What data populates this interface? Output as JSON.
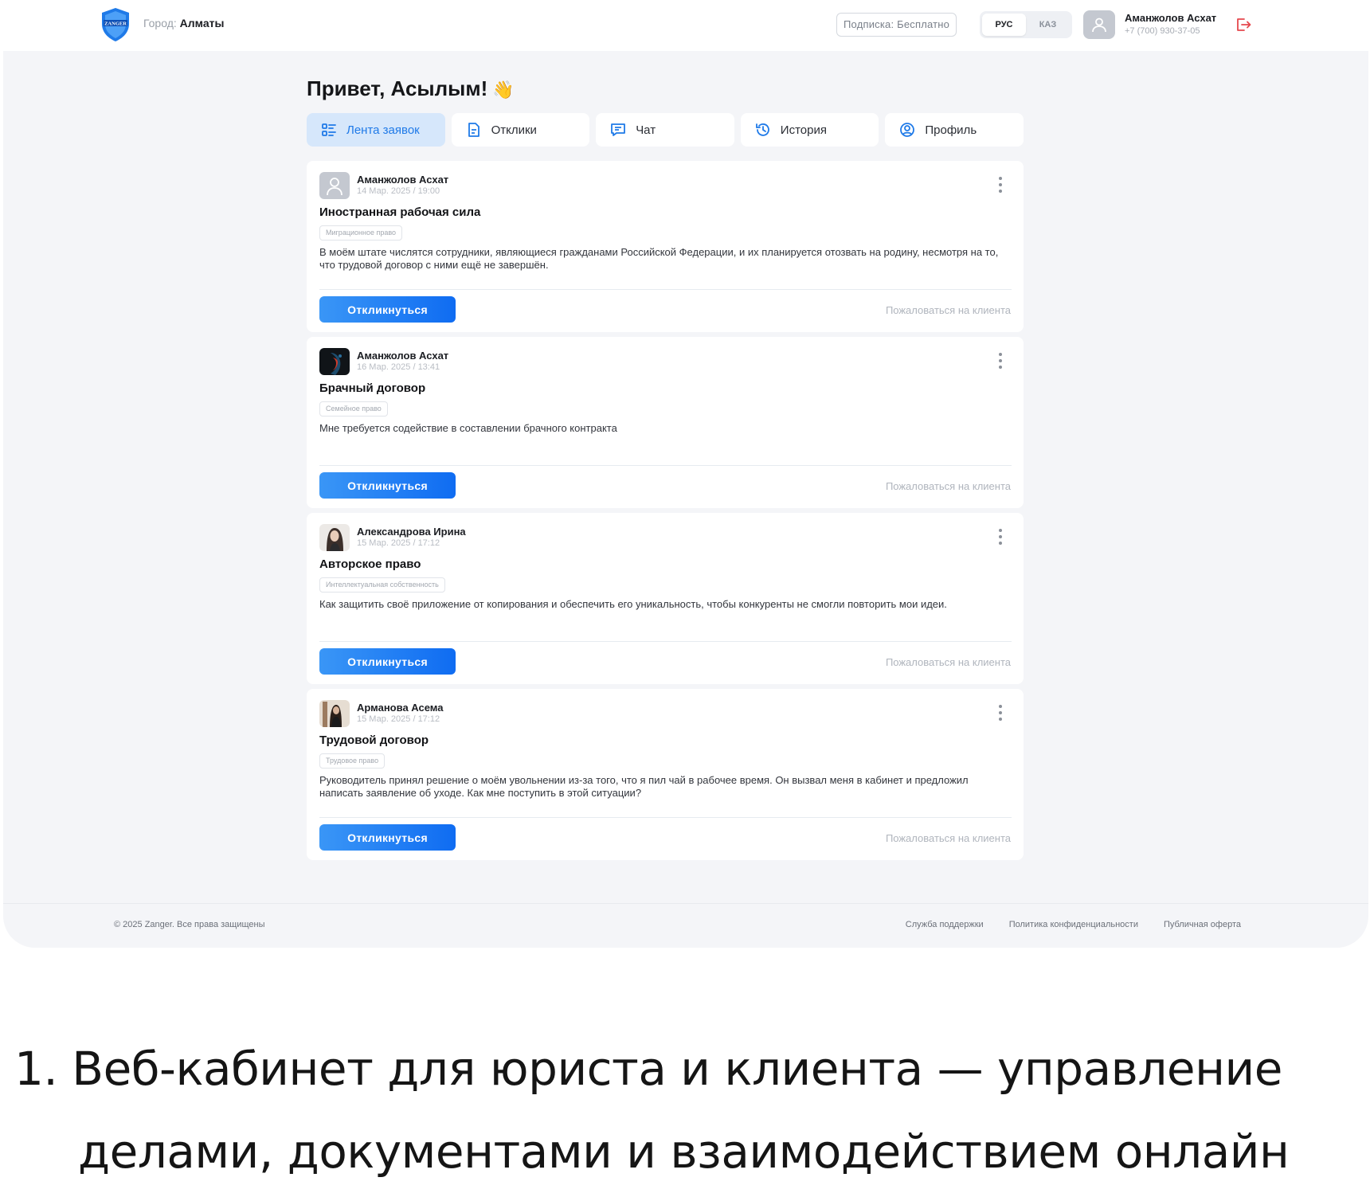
{
  "header": {
    "city_label": "Город:",
    "city_value": "Алматы",
    "subscription": "Подписка: Бесплатно",
    "languages": [
      "РУС",
      "КАЗ"
    ],
    "active_language": "РУС",
    "user_name": "Аманжолов Асхат",
    "user_phone": "+7 (700) 930-37-05",
    "brand_color": "#1f7ae8",
    "logout_color": "#e5484d"
  },
  "main": {
    "greeting": "Привет, Асылым!",
    "greeting_emoji": "👋",
    "tabs": [
      {
        "label": "Лента заявок",
        "icon": "list-icon",
        "active": true
      },
      {
        "label": "Отклики",
        "icon": "document-icon",
        "active": false
      },
      {
        "label": "Чат",
        "icon": "chat-icon",
        "active": false
      },
      {
        "label": "История",
        "icon": "history-icon",
        "active": false
      },
      {
        "label": "Профиль",
        "icon": "user-circle-icon",
        "active": false
      }
    ]
  },
  "feed": {
    "respond_label": "Откликнуться",
    "report_label": "Пожаловаться на клиента",
    "requests": [
      {
        "author": "Аманжолов Асхат",
        "date": "14 Мар. 2025 / 19:00",
        "title": "Иностранная рабочая сила",
        "tag": "Миграционное право",
        "text": "В моём штате числятся сотрудники, являющиеся гражданами Российской Федерации, и их планируется отозвать на родину, несмотря на то, что трудовой договор с ними ещё не завершён.",
        "avatar": "placeholder-avatar"
      },
      {
        "author": "Аманжолов Асхат",
        "date": "16 Мар. 2025 / 13:41",
        "title": "Брачный договор",
        "tag": "Семейное право",
        "text": "Мне требуется содействие в составлении брачного контракта",
        "avatar": "photo-avatar"
      },
      {
        "author": "Александрова Ирина",
        "date": "15 Мар. 2025 / 17:12",
        "title": "Авторское право",
        "tag": "Интеллектуальная собственность",
        "text": "Как защитить своё приложение от копирования и обеспечить его уникальность, чтобы конкуренты не смогли повторить мои идеи.",
        "avatar": "photo-avatar"
      },
      {
        "author": "Арманова Асема",
        "date": "15 Мар. 2025 / 17:12",
        "title": "Трудовой договор",
        "tag": "Трудовое право",
        "text": "Руководитель принял решение о моём увольнении из-за того, что я пил чай в рабочее время. Он вызвал меня в кабинет и предложил написать заявление об уходе. Как мне поступить в этой ситуации?",
        "avatar": "photo-avatar"
      }
    ]
  },
  "footer": {
    "copyright": "© 2025 Zanger. Все права защищены",
    "links": [
      "Служба поддержки",
      "Политика конфиденциальности",
      "Публичная оферта"
    ]
  },
  "caption": {
    "line1": "1. Веб-кабинет для юриста и клиента — управление",
    "line2": "делами, документами и взаимодействием онлайн"
  }
}
